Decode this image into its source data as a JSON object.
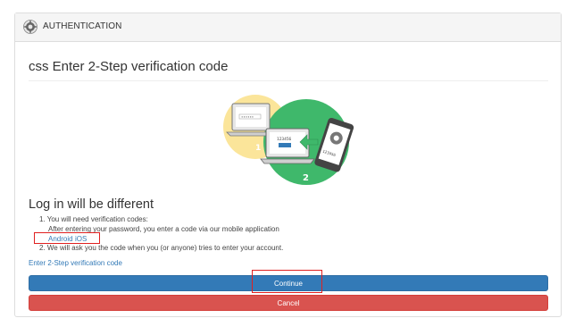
{
  "header": {
    "title": "AUTHENTICATION",
    "icon": "gear-logo-icon"
  },
  "page": {
    "title": "css Enter 2-Step verification code",
    "subheading": "Log in will be different"
  },
  "illustration": {
    "step1_number": "1",
    "step2_number": "2",
    "screen_code": "123456",
    "phone_code": "123456"
  },
  "steps": {
    "step1": "1. You will need verification codes:",
    "step1_detail": "After entering your password, you enter a code via our mobile application",
    "android_link": "Android",
    "ios_link": "iOS",
    "step2": "2. We will ask you the code when you (or anyone) tries to enter your account."
  },
  "links": {
    "enter_code": "Enter 2-Step verification code"
  },
  "buttons": {
    "continue": "Continue",
    "cancel": "Cancel"
  },
  "colors": {
    "primary": "#337ab7",
    "danger": "#d9534f",
    "highlight": "#e02020",
    "illustration_yellow": "#fbe59a",
    "illustration_green": "#3fb86b"
  }
}
